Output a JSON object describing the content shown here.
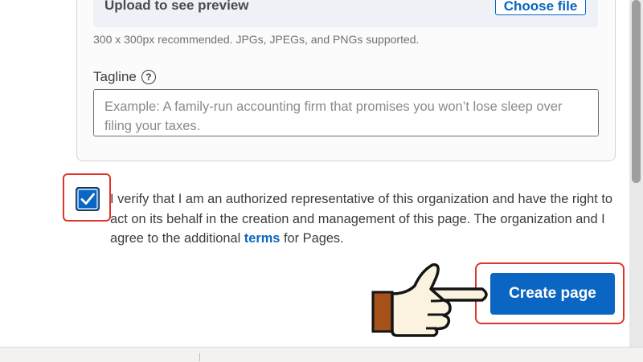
{
  "upload": {
    "preview_text": "Upload to see preview",
    "choose_file_label": "Choose file",
    "size_hint": "300 x 300px recommended. JPGs, JPEGs, and PNGs supported."
  },
  "tagline": {
    "label": "Tagline",
    "help_glyph": "?",
    "value": "",
    "placeholder": "Example: A family-run accounting firm that promises you won’t lose sleep over filing your taxes."
  },
  "verification": {
    "checked": true,
    "checkmark": "✓",
    "text_before": "I verify that I am an authorized representative of this organization and have the right to act on its behalf in the creation and management of this page. The organization and I agree to the additional ",
    "link_text": "terms",
    "text_after": " for Pages."
  },
  "actions": {
    "create_page_label": "Create page"
  },
  "annotations": {
    "highlight_color": "#e0342b",
    "pointer_icon": "pointing-hand-icon"
  },
  "colors": {
    "accent": "#0a66c2"
  }
}
